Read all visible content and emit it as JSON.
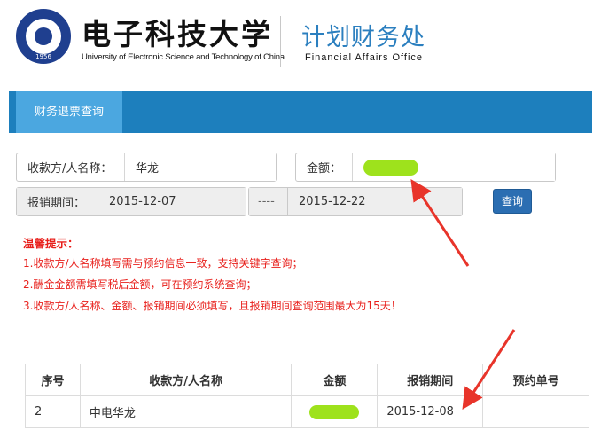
{
  "header": {
    "university_cn": "电子科技大学",
    "university_en": "University of Electronic Science and Technology of China",
    "seal_year": "1956",
    "department_cn": "计划财务处",
    "department_en": "Financial  Affairs  Office"
  },
  "nav": {
    "active_tab": "财务退票查询"
  },
  "form": {
    "payee_label": "收款方/人名称：",
    "payee_value": "华龙",
    "amount_label": "金额：",
    "date_label": "报销期间：",
    "date_start": "2015-12-07",
    "date_separator": "----",
    "date_end": "2015-12-22",
    "query_button": "查询"
  },
  "tips": {
    "title": "温馨提示：",
    "lines": [
      "1.收款方/人名称填写需与预约信息一致，支持关键字查询；",
      "2.酬金金额需填写税后金额，可在预约系统查询；",
      "3.收款方/人名称、金额、报销期间必须填写，且报销期间查询范围最大为15天！"
    ]
  },
  "table": {
    "headers": [
      "序号",
      "收款方/人名称",
      "金额",
      "报销期间",
      "预约单号"
    ],
    "rows": [
      {
        "index": "2",
        "payee": "中电华龙",
        "date": "2015-12-08",
        "order_no": ""
      }
    ]
  },
  "colors": {
    "brand_blue": "#1d7fbd",
    "active_tab": "#4ba7e0",
    "tip_red": "#e8201c",
    "redaction_green": "#9ee21c",
    "annotation_arrow": "#e8342a"
  }
}
